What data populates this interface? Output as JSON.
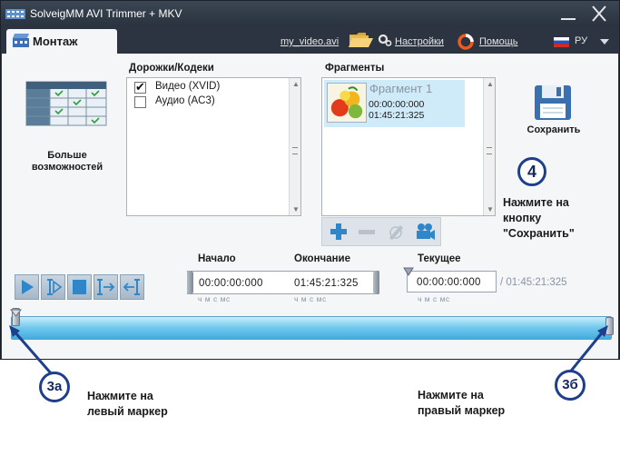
{
  "window": {
    "title": "SolveigMM AVI Trimmer + MKV"
  },
  "toolbar": {
    "tab_label": "Монтаж",
    "file_link": "my_video.avi",
    "settings_label": "Настройки",
    "help_label": "Помощь",
    "language": "РУ"
  },
  "left_panel": {
    "more_label_line1": "Больше",
    "more_label_line2": "возможностей"
  },
  "tracks": {
    "header": "Дорожки/Кодеки",
    "items": [
      {
        "label": "Видео (XVID)",
        "checked": true
      },
      {
        "label": "Аудио (AC3)",
        "checked": false
      }
    ]
  },
  "fragments": {
    "header": "Фрагменты",
    "items": [
      {
        "title": "Фрагмент 1",
        "start": "00:00:00:000",
        "end": "01:45:21:325"
      }
    ]
  },
  "save": {
    "label": "Сохранить"
  },
  "annotations": {
    "step4": "4",
    "step4_hint_line1": "Нажмите на",
    "step4_hint_line2": "кнопку",
    "step4_hint_line3": "\"Сохранить\"",
    "step3a": "3а",
    "step3a_hint_line1": "Нажмите на",
    "step3a_hint_line2": "левый маркер",
    "step3b": "3б",
    "step3b_hint_line1": "Нажмите на",
    "step3b_hint_line2": "правый маркер"
  },
  "time": {
    "start_label": "Начало",
    "end_label": "Окончание",
    "current_label": "Текущее",
    "start_value": "00:00:00:000",
    "end_value": "01:45:21:325",
    "current_value": "00:00:00:000",
    "total_value": "/ 01:45:21:325",
    "units": "ч м с мс"
  },
  "colors": {
    "window_dark": "#2b3440",
    "panel_bg": "#f4f6f8",
    "timeline_blue": "#42acdc",
    "annotation_blue": "#1e3f8c"
  },
  "icons": [
    "app-icon",
    "film-icon",
    "folder-icon",
    "gear-icon",
    "help-icon",
    "flag-icon",
    "chevron-down-icon",
    "table-grid-icon",
    "floppy-disk-icon",
    "plus-icon",
    "minus-icon",
    "edit-icon",
    "camera-icon",
    "play-icon",
    "step-icon",
    "stop-icon",
    "go-to-end-icon",
    "go-to-start-icon"
  ]
}
